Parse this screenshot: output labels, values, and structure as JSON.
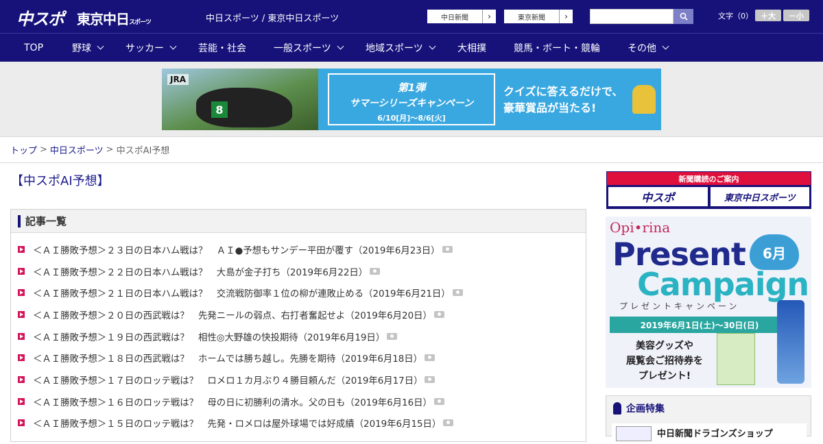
{
  "header": {
    "logo_main": "中スポ",
    "logo_tokyo": "東京中日",
    "logo_tokyo_sub": "スポーツ",
    "site_name": "中日スポーツ / 東京中日スポーツ",
    "links": [
      {
        "label": "中日新聞"
      },
      {
        "label": "東京新聞"
      }
    ],
    "search": {
      "placeholder": "",
      "value": "",
      "icon": "search-icon"
    },
    "font_size": {
      "label": "文字（0）",
      "increase": "＋大",
      "decrease": "－小"
    }
  },
  "nav": {
    "items": [
      {
        "label": "TOP",
        "dropdown": false
      },
      {
        "label": "野球",
        "dropdown": true
      },
      {
        "label": "サッカー",
        "dropdown": true
      },
      {
        "label": "芸能・社会",
        "dropdown": false
      },
      {
        "label": "一般スポーツ",
        "dropdown": true
      },
      {
        "label": "地域スポーツ",
        "dropdown": true
      },
      {
        "label": "大相撲",
        "dropdown": false
      },
      {
        "label": "競馬・ボート・競輪",
        "dropdown": false
      },
      {
        "label": "その他",
        "dropdown": true
      }
    ]
  },
  "banner": {
    "brand": "JRA",
    "number": "8",
    "campaign_line1": "第1弾",
    "campaign_line2": "サマーシリーズキャンペーン",
    "campaign_dates": "6/10[月]～8/6[火]",
    "copy_line1": "クイズに答えるだけで、",
    "copy_line2": "豪華賞品が当たる!"
  },
  "breadcrumb": {
    "items": [
      "トップ",
      "中日スポーツ",
      "中スポAI予想"
    ],
    "separator": ">"
  },
  "page_title": "【中スポAI予想】",
  "article_list": {
    "heading": "記事一覧",
    "items": [
      "＜ＡＩ勝敗予想＞２３日の日本ハム戦は？　ＡＩ●予想もサンデー平田が覆す（2019年6月23日）",
      "＜ＡＩ勝敗予想＞２２日の日本ハム戦は？　大島が金子打ち（2019年6月22日）",
      "＜ＡＩ勝敗予想＞２１日の日本ハム戦は？　交流戦防御率１位の柳が連敗止める（2019年6月21日）",
      "＜ＡＩ勝敗予想＞２０日の西武戦は？　先発ニールの弱点、右打者奮起せよ（2019年6月20日）",
      "＜ＡＩ勝敗予想＞１９日の西武戦は？　相性◎大野雄の快投期待（2019年6月19日）",
      "＜ＡＩ勝敗予想＞１８日の西武戦は？　ホームでは勝ち越し。先勝を期待（2019年6月18日）",
      "＜ＡＩ勝敗予想＞１７日のロッテ戦は？　ロメロ１カ月ぶり４勝目頼んだ（2019年6月17日）",
      "＜ＡＩ勝敗予想＞１６日のロッテ戦は？　母の日に初勝利の清水。父の日も（2019年6月16日）",
      "＜ＡＩ勝敗予想＞１５日のロッテ戦は？　先発・ロメロは屋外球場では好成績（2019年6月15日）"
    ]
  },
  "sidebar": {
    "subscribe_heading": "新聞購読のご案内",
    "subscribe_logos": [
      "中スポ",
      "東京中日スポーツ"
    ],
    "present_ad": {
      "brand": "Opi•rina",
      "title1": "Present",
      "title2": "Campaign",
      "month": "6月",
      "kana": "プレゼントキャンペーン",
      "dates": "2019年6月1日(土)～30日(日)",
      "gift_line1": "美容グッズや",
      "gift_line2": "展覧会ご招待券を",
      "gift_line3": "プレゼント!"
    },
    "feature_heading": "企画特集",
    "feature_item": "中日新聞ドラゴンズショップ"
  },
  "colors": {
    "brand_navy": "#16127a",
    "accent_red": "#d4145a",
    "link": "#1a1a8c"
  }
}
